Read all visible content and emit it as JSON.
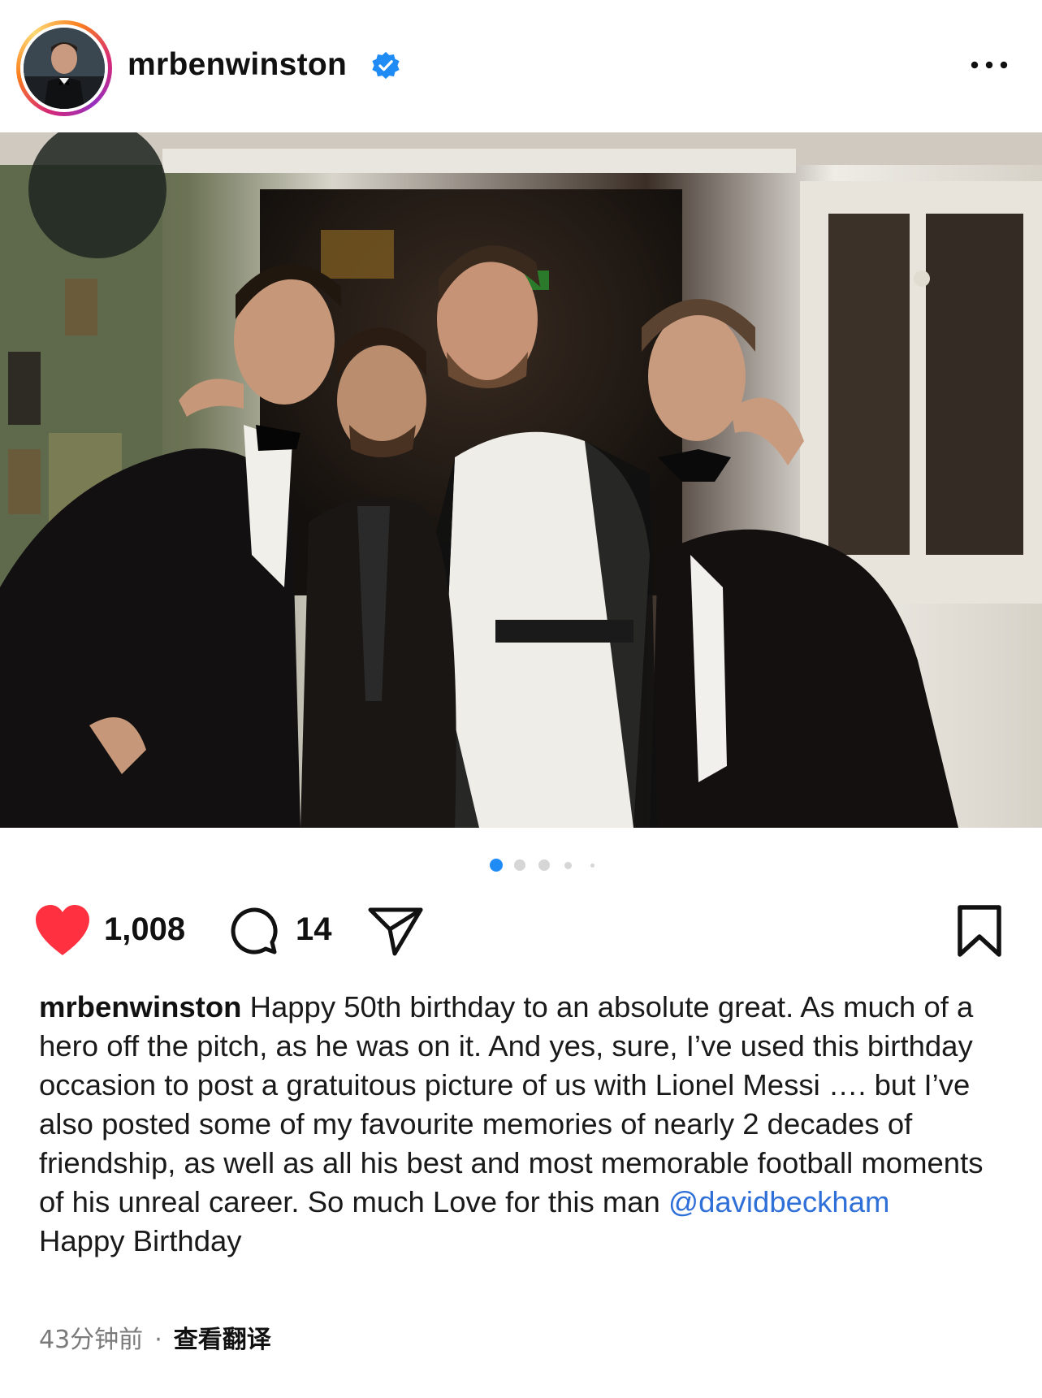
{
  "header": {
    "username": "mrbenwinston",
    "verified": true,
    "more_icon": "more-horizontal-icon"
  },
  "post": {
    "image_alt_present": false,
    "carousel": {
      "count": 5,
      "active_index": 0
    }
  },
  "actions": {
    "like_count": "1,008",
    "comment_count": "14",
    "liked": true,
    "like_color": "#ff3040"
  },
  "caption": {
    "username": "mrbenwinston",
    "text": "Happy 50th birthday to an absolute great. As much of a hero off the pitch, as he was on it. And yes, sure, I’ve used this birthday occasion to post a gratuitous picture of us with Lionel Messi …. but I’ve also posted some of my favourite memories of nearly 2 decades of friendship, as well as all his best and most memorable football moments of his unreal career. So much Love for this man ",
    "mention": "@davidbeckham",
    "tail": "Happy Birthday"
  },
  "meta": {
    "time": "43分钟前",
    "separator": "·",
    "translate": "查看翻译"
  },
  "colors": {
    "verified_blue": "#1f8bf5",
    "mention_blue": "#2f6fd8",
    "dot_active": "#1f8bf5"
  }
}
